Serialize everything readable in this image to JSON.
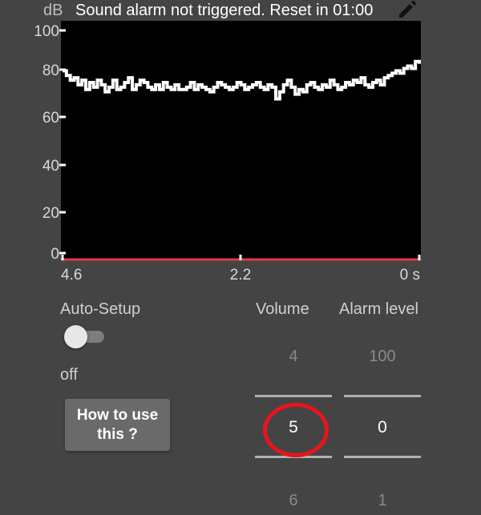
{
  "header": {
    "unit": "dB",
    "status": "Sound alarm not triggered. Reset in  01:00",
    "edit_icon": "pencil-icon"
  },
  "chart_data": {
    "type": "line",
    "title": "",
    "xlabel": "",
    "ylabel": "dB",
    "y_ticks": [
      "100",
      "80",
      "60",
      "40",
      "20",
      "0"
    ],
    "x_ticks": [
      "4.6",
      "2.2",
      "0 s"
    ],
    "ylim": [
      0,
      100
    ],
    "xlim": [
      4.6,
      0
    ],
    "grid": false,
    "threshold": 0,
    "series": [
      {
        "x": [
          4.6,
          4.55,
          4.5,
          4.45,
          4.4,
          4.35,
          4.3,
          4.25,
          4.2,
          4.15,
          4.1,
          4.05,
          4.0,
          3.95,
          3.9,
          3.85,
          3.8,
          3.75,
          3.7,
          3.65,
          3.6,
          3.55,
          3.5,
          3.45,
          3.4,
          3.35,
          3.3,
          3.25,
          3.2,
          3.15,
          3.1,
          3.05,
          3.0,
          2.95,
          2.9,
          2.85,
          2.8,
          2.75,
          2.7,
          2.65,
          2.6,
          2.55,
          2.5,
          2.45,
          2.4,
          2.35,
          2.3,
          2.25,
          2.2,
          2.15,
          2.1,
          2.05,
          2.0,
          1.95,
          1.9,
          1.85,
          1.8,
          1.75,
          1.7,
          1.65,
          1.6,
          1.55,
          1.5,
          1.45,
          1.4,
          1.35,
          1.3,
          1.25,
          1.2,
          1.15,
          1.1,
          1.05,
          1.0,
          0.95,
          0.9,
          0.85,
          0.8,
          0.75,
          0.7,
          0.65,
          0.6,
          0.55,
          0.5,
          0.45,
          0.4,
          0.35,
          0.3,
          0.25,
          0.2,
          0.15,
          0.1,
          0.05,
          0.0
        ],
        "values": [
          80,
          78,
          76,
          77,
          74,
          76,
          72,
          75,
          73,
          76,
          74,
          71,
          73,
          76,
          72,
          73,
          75,
          77,
          72,
          74,
          76,
          75,
          73,
          72,
          74,
          72,
          75,
          73,
          72,
          74,
          72,
          72,
          73,
          75,
          72,
          74,
          73,
          72,
          71,
          73,
          75,
          74,
          73,
          72,
          73,
          75,
          74,
          72,
          73,
          74,
          75,
          73,
          72,
          74,
          73,
          68,
          71,
          74,
          76,
          73,
          70,
          72,
          71,
          74,
          75,
          73,
          72,
          74,
          73,
          76,
          74,
          72,
          73,
          75,
          74,
          76,
          75,
          77,
          74,
          73,
          75,
          76,
          74,
          77,
          78,
          79,
          80,
          79,
          81,
          82,
          81,
          84,
          83
        ]
      }
    ]
  },
  "controls": {
    "autosetup_label": "Auto-Setup",
    "autosetup_state": "off",
    "howto_label_1": "How to use",
    "howto_label_2": "this ?",
    "volume": {
      "title": "Volume",
      "prev": "4",
      "current": "5",
      "next": "6"
    },
    "alarm": {
      "title": "Alarm level",
      "prev": "100",
      "current": "0",
      "next": "1"
    }
  },
  "colors": {
    "background": "#444444",
    "plot_bg": "#000000",
    "line": "#ffffff",
    "threshold_line": "#e53935",
    "highlight": "#e8141e"
  }
}
